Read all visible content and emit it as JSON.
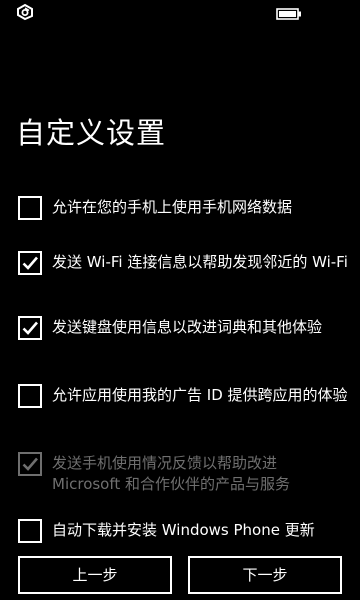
{
  "status_bar": {
    "left_icon": "notification-glyph-icon",
    "battery_icon": "battery-icon"
  },
  "page": {
    "title": "自定义设置"
  },
  "options": [
    {
      "label": "允许在您的手机上使用手机网络数据",
      "checked": false,
      "enabled": true
    },
    {
      "label": "发送 Wi-Fi 连接信息以帮助发现邻近的 Wi-Fi",
      "checked": true,
      "enabled": true
    },
    {
      "label": "发送键盘使用信息以改进词典和其他体验",
      "checked": true,
      "enabled": true
    },
    {
      "label": "允许应用使用我的广告 ID 提供跨应用的体验",
      "checked": false,
      "enabled": true
    },
    {
      "label": "发送手机使用情况反馈以帮助改进 Microsoft 和合作伙伴的产品与服务",
      "checked": true,
      "enabled": false
    },
    {
      "label": "自动下载并安装 Windows Phone 更新",
      "checked": false,
      "enabled": true
    }
  ],
  "buttons": {
    "back": "上一步",
    "next": "下一步"
  },
  "colors": {
    "background": "#000000",
    "foreground": "#ffffff",
    "disabled": "#6f6f6f"
  }
}
